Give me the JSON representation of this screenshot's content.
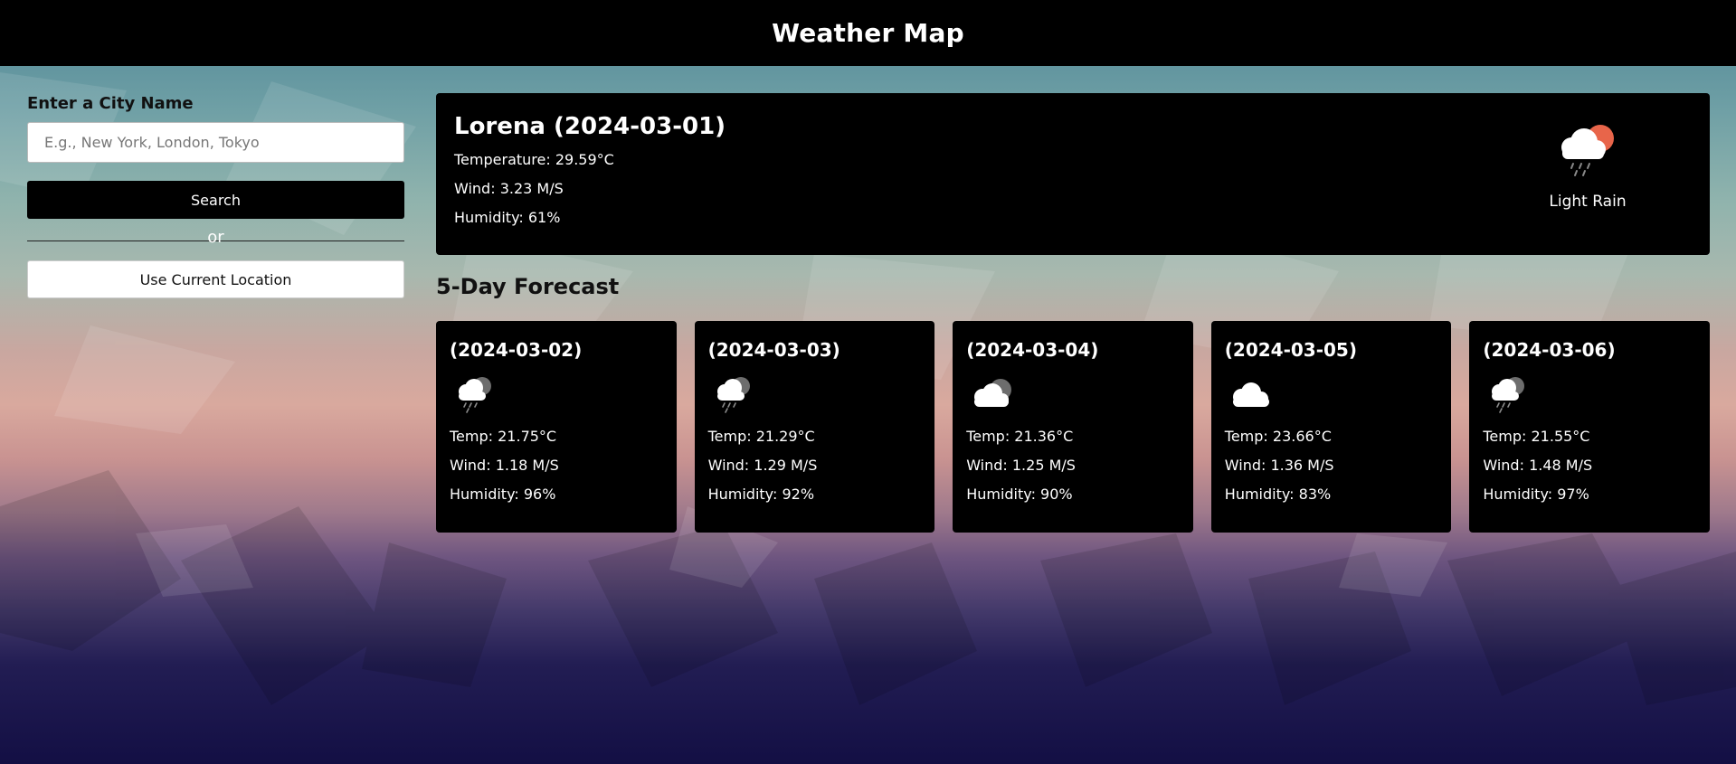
{
  "app": {
    "title": "Weather Map"
  },
  "search": {
    "label": "Enter a City Name",
    "placeholder": "E.g., New York, London, Tokyo",
    "button_label": "Search",
    "divider_label": "or",
    "location_button_label": "Use Current Location"
  },
  "current": {
    "heading": "Lorena (2024-03-01)",
    "temperature": "Temperature: 29.59°C",
    "wind": "Wind: 3.23 M/S",
    "humidity": "Humidity: 61%",
    "icon": "light-rain-sun-icon",
    "description": "Light Rain"
  },
  "forecast": {
    "title": "5-Day Forecast",
    "days": [
      {
        "date": "(2024-03-02)",
        "icon": "rain-cloud-icon",
        "temp": "Temp: 21.75°C",
        "wind": "Wind: 1.18 M/S",
        "humidity": "Humidity: 96%"
      },
      {
        "date": "(2024-03-03)",
        "icon": "rain-cloud-icon",
        "temp": "Temp: 21.29°C",
        "wind": "Wind: 1.29 M/S",
        "humidity": "Humidity: 92%"
      },
      {
        "date": "(2024-03-04)",
        "icon": "broken-clouds-icon",
        "temp": "Temp: 21.36°C",
        "wind": "Wind: 1.25 M/S",
        "humidity": "Humidity: 90%"
      },
      {
        "date": "(2024-03-05)",
        "icon": "cloud-icon",
        "temp": "Temp: 23.66°C",
        "wind": "Wind: 1.36 M/S",
        "humidity": "Humidity: 83%"
      },
      {
        "date": "(2024-03-06)",
        "icon": "rain-cloud-icon",
        "temp": "Temp: 21.55°C",
        "wind": "Wind: 1.48 M/S",
        "humidity": "Humidity: 97%"
      }
    ]
  },
  "colors": {
    "panel": "#000000",
    "sun": "#e8654a"
  }
}
